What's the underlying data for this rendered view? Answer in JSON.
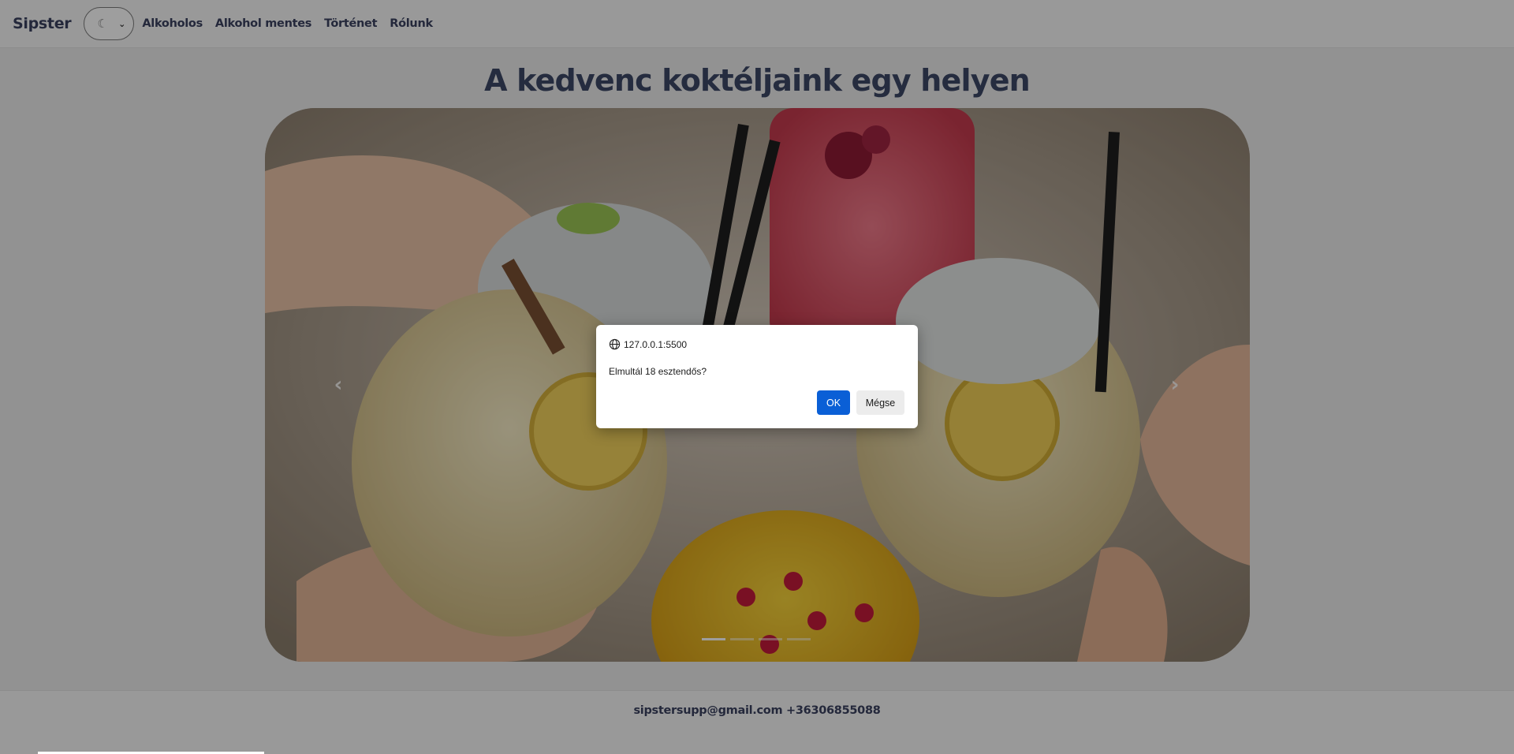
{
  "navbar": {
    "brand": "Sipster",
    "theme_select": {
      "icon": "moon-icon",
      "value": "☾"
    },
    "links": [
      "Alkoholos",
      "Alkohol mentes",
      "Történet",
      "Rólunk"
    ]
  },
  "hero": {
    "title": "A kedvenc koktéljaink egy helyen"
  },
  "carousel": {
    "image_alt": "cocktails-toast-photo",
    "prev_glyph": "‹",
    "next_glyph": "›",
    "indicator_count": 4,
    "active_indicator": 1
  },
  "footer": {
    "contact": "sipstersupp@gmail.com +36306855088"
  },
  "dialog": {
    "origin": "127.0.0.1:5500",
    "message": "Elmultál 18 esztendős?",
    "ok_label": "OK",
    "cancel_label": "Mégse"
  },
  "colors": {
    "nav_text": "#3a4260",
    "ok_button": "#0a5fd6",
    "overlay": "rgba(0,0,0,0.38)"
  }
}
